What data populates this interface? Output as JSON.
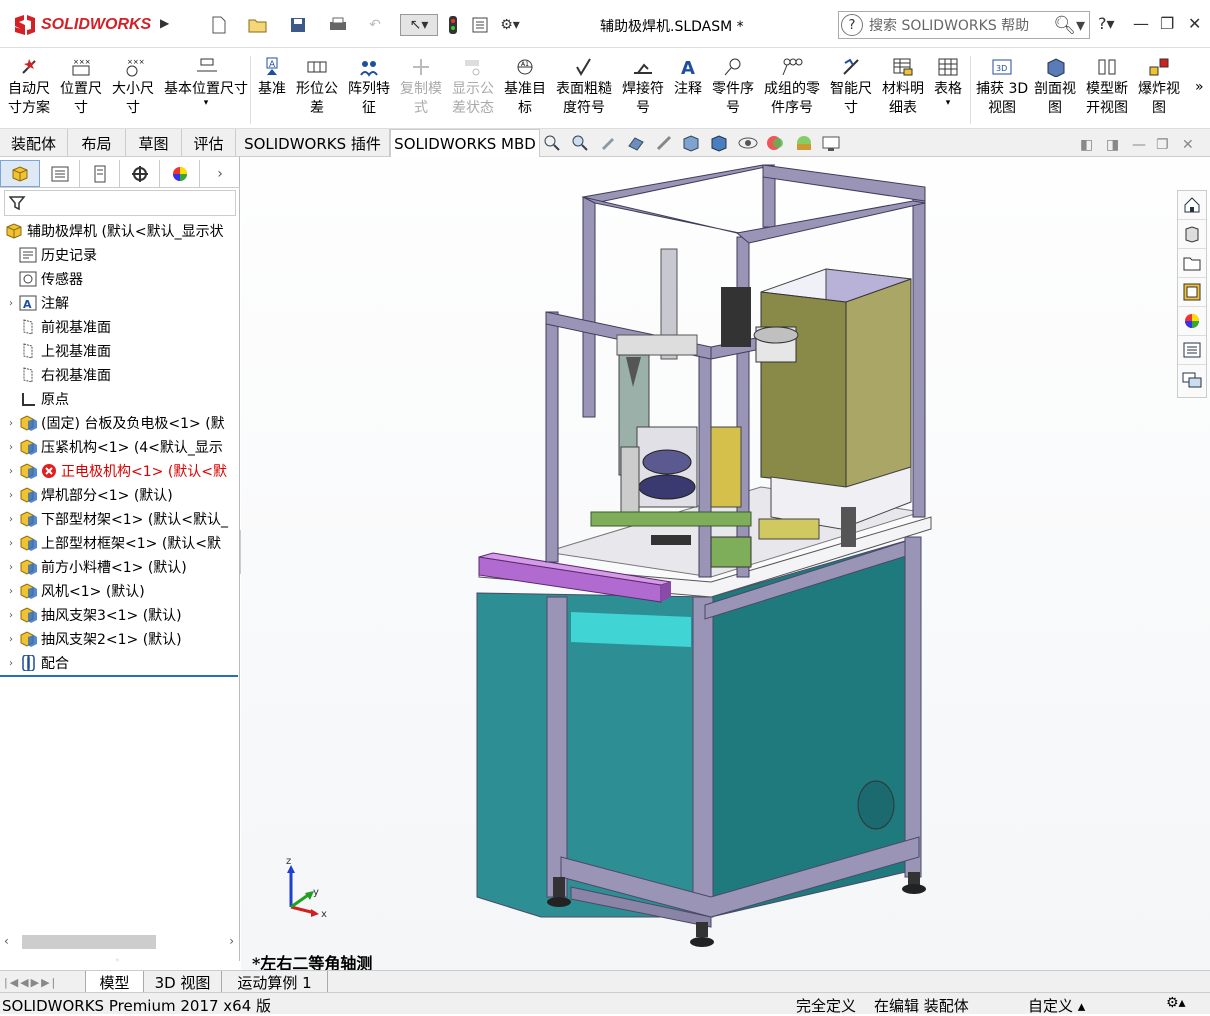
{
  "app": {
    "name": "SOLIDWORKS",
    "document_title": "辅助极焊机.SLDASM *"
  },
  "help_search": {
    "placeholder": "搜索 SOLIDWORKS 帮助"
  },
  "window": {
    "help_label": "?",
    "minimize": "—",
    "restore": "❐",
    "close": "✕"
  },
  "commands": [
    {
      "label": "自动尺\n寸方案",
      "icon": "auto-dimension-icon",
      "enabled": true
    },
    {
      "label": "位置尺\n寸",
      "icon": "location-dimension-icon",
      "enabled": true
    },
    {
      "label": "大小尺\n寸",
      "icon": "size-dimension-icon",
      "enabled": true
    },
    {
      "label": "基本位置尺寸",
      "icon": "basic-location-dimension-icon",
      "enabled": true
    },
    {
      "label": "基准",
      "icon": "datum-icon",
      "enabled": true
    },
    {
      "label": "形位公\n差",
      "icon": "geometric-tolerance-icon",
      "enabled": true
    },
    {
      "label": "阵列特\n征",
      "icon": "pattern-feature-icon",
      "enabled": true
    },
    {
      "label": "复制模\n式",
      "icon": "copy-scheme-icon",
      "enabled": false
    },
    {
      "label": "显示公\n差状态",
      "icon": "tolerance-status-icon",
      "enabled": false
    },
    {
      "label": "基准目\n标",
      "icon": "datum-target-icon",
      "enabled": true
    },
    {
      "label": "表面粗糙\n度符号",
      "icon": "surface-finish-icon",
      "enabled": true
    },
    {
      "label": "焊接符\n号",
      "icon": "weld-symbol-icon",
      "enabled": true
    },
    {
      "label": "注释",
      "icon": "note-icon",
      "enabled": true
    },
    {
      "label": "零件序\n号",
      "icon": "balloon-icon",
      "enabled": true
    },
    {
      "label": "成组的零\n件序号",
      "icon": "stacked-balloon-icon",
      "enabled": true
    },
    {
      "label": "智能尺\n寸",
      "icon": "smart-dimension-icon",
      "enabled": true
    },
    {
      "label": "材料明\n细表",
      "icon": "bom-icon",
      "enabled": true
    },
    {
      "label": "表格",
      "icon": "table-icon",
      "enabled": true
    },
    {
      "label": "捕获 3D\n视图",
      "icon": "capture-3d-view-icon",
      "enabled": true
    },
    {
      "label": "剖面视\n图",
      "icon": "section-view-icon",
      "enabled": true
    },
    {
      "label": "模型断\n开视图",
      "icon": "model-break-view-icon",
      "enabled": true
    },
    {
      "label": "爆炸视\n图",
      "icon": "exploded-view-icon",
      "enabled": true
    }
  ],
  "tabs": [
    "装配体",
    "布局",
    "草图",
    "评估",
    "SOLIDWORKS 插件",
    "SOLIDWORKS MBD"
  ],
  "active_tab": "SOLIDWORKS MBD",
  "tree": {
    "root": "辅助极焊机 (默认<默认_显示状",
    "items": [
      {
        "label": "历史记录",
        "icon": "history-icon",
        "expandable": false,
        "error": false
      },
      {
        "label": "传感器",
        "icon": "sensor-icon",
        "expandable": false,
        "error": false
      },
      {
        "label": "注解",
        "icon": "annotation-icon",
        "expandable": true,
        "error": false
      },
      {
        "label": "前视基准面",
        "icon": "plane-icon",
        "expandable": false,
        "error": false
      },
      {
        "label": "上视基准面",
        "icon": "plane-icon",
        "expandable": false,
        "error": false
      },
      {
        "label": "右视基准面",
        "icon": "plane-icon",
        "expandable": false,
        "error": false
      },
      {
        "label": "原点",
        "icon": "origin-icon",
        "expandable": false,
        "error": false
      },
      {
        "label": "(固定) 台板及负电极<1> (默",
        "icon": "subassembly-icon",
        "expandable": true,
        "error": false
      },
      {
        "label": "压紧机构<1> (4<默认_显示",
        "icon": "subassembly-icon",
        "expandable": true,
        "error": false
      },
      {
        "label": "正电极机构<1> (默认<默",
        "icon": "subassembly-icon",
        "expandable": true,
        "error": true
      },
      {
        "label": "焊机部分<1> (默认)",
        "icon": "subassembly-icon",
        "expandable": true,
        "error": false
      },
      {
        "label": "下部型材架<1> (默认<默认_",
        "icon": "subassembly-icon",
        "expandable": true,
        "error": false
      },
      {
        "label": "上部型材框架<1> (默认<默",
        "icon": "subassembly-icon",
        "expandable": true,
        "error": false
      },
      {
        "label": "前方小料槽<1> (默认)",
        "icon": "subassembly-icon",
        "expandable": true,
        "error": false
      },
      {
        "label": "风机<1> (默认)",
        "icon": "subassembly-icon",
        "expandable": true,
        "error": false
      },
      {
        "label": "抽风支架3<1> (默认)",
        "icon": "subassembly-icon",
        "expandable": true,
        "error": false
      },
      {
        "label": "抽风支架2<1> (默认)",
        "icon": "subassembly-icon",
        "expandable": true,
        "error": false
      },
      {
        "label": "配合",
        "icon": "mates-icon",
        "expandable": true,
        "error": false
      }
    ]
  },
  "viewport": {
    "view_name": "*左右二等角轴测",
    "triad": {
      "x": "x",
      "y": "y",
      "z": "z"
    }
  },
  "bottom_tabs": [
    "模型",
    "3D 视图",
    "运动算例 1"
  ],
  "status": {
    "product": "SOLIDWORKS Premium 2017 x64 版",
    "definition": "完全定义",
    "mode": "在编辑 装配体",
    "units": "自定义"
  },
  "colors": {
    "accent": "#d42027",
    "panel_teal": "#1f7a7e",
    "frame": "#8a84a6",
    "tray": "#b06ad0"
  }
}
